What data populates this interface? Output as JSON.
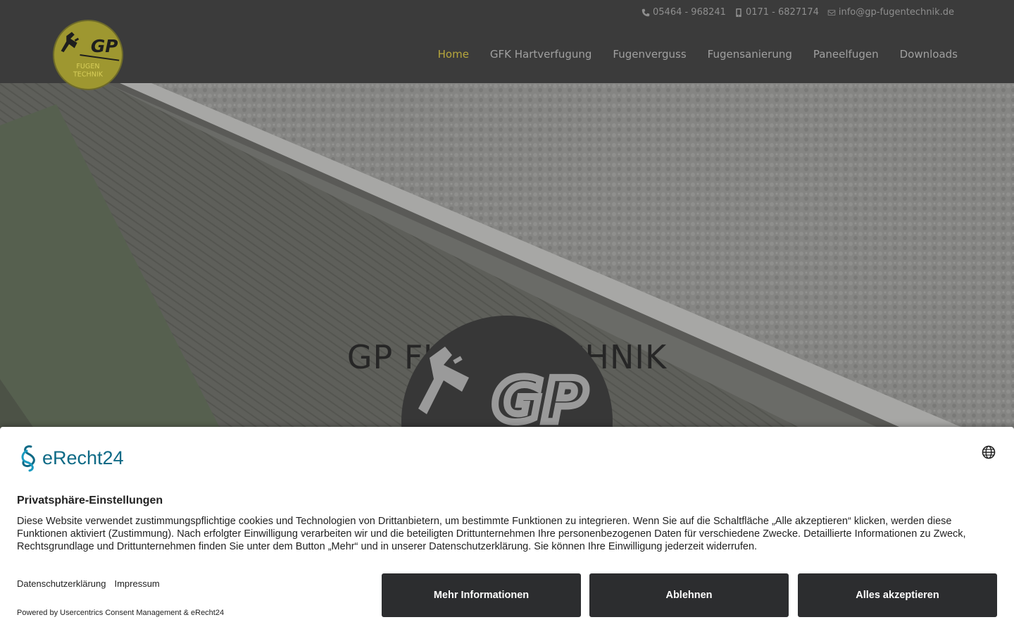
{
  "header": {
    "contacts": [
      {
        "icon": "phone-icon",
        "text": "05464 - 968241"
      },
      {
        "icon": "mobile-icon",
        "text": "0171 - 6827174"
      },
      {
        "icon": "envelope-icon",
        "text": "info@gp-fugentechnik.de"
      }
    ],
    "logo": {
      "brand": "GP",
      "line1": "FUGEN",
      "line2": "TECHNIK"
    },
    "nav": [
      {
        "label": "Home",
        "active": true
      },
      {
        "label": "GFK Hartverfugung"
      },
      {
        "label": "Fugenverguss"
      },
      {
        "label": "Fugensanierung"
      },
      {
        "label": "Paneelfugen"
      },
      {
        "label": "Downloads"
      }
    ]
  },
  "hero": {
    "title": "GP FUGENTECHNIK"
  },
  "consent": {
    "brand": "eRecht24",
    "title": "Privatsphäre-Einstellungen",
    "text": "Diese Website verwendet zustimmungspflichtige cookies und Technologien von Drittanbietern, um bestimmte Funktionen zu integrieren. Wenn Sie auf die Schaltfläche „Alle akzeptieren“ klicken, werden diese Funktionen aktiviert (Zustimmung). Nach erfolgter Einwilligung verarbeiten wir und die beteiligten Drittunternehmen Ihre personenbezogenen Daten für verschiedene Zwecke. Detaillierte Informationen zu Zweck, Rechtsgrundlage und Drittunternehmen finden Sie unter dem Button „Mehr“ und in unserer Datenschutzerklärung. Sie können Ihre Einwilligung jederzeit widerrufen.",
    "links": [
      "Datenschutzerklärung",
      "Impressum"
    ],
    "powered": "Powered by Usercentrics Consent Management & eRecht24",
    "buttons": {
      "more": "Mehr Informationen",
      "decline": "Ablehnen",
      "accept": "Alles akzeptieren"
    }
  },
  "colors": {
    "header_bg": "#3b3b3b",
    "nav_active": "#b7a73c",
    "logo_gold": "#9e9730",
    "button_bg": "#2c2d2f",
    "brand_teal": "#0e6a86"
  }
}
